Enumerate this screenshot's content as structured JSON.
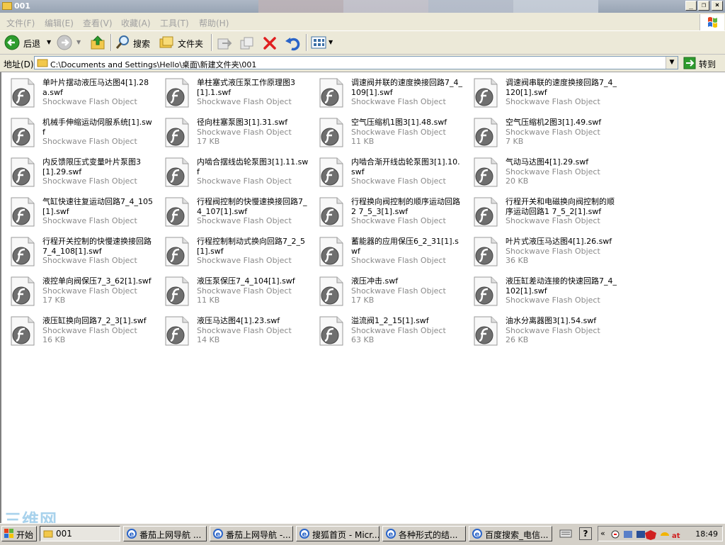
{
  "window": {
    "title": "001"
  },
  "menu": [
    "文件(F)",
    "编辑(E)",
    "查看(V)",
    "收藏(A)",
    "工具(T)",
    "帮助(H)"
  ],
  "toolbar": {
    "back_label": "后退",
    "search_label": "搜索",
    "folders_label": "文件夹"
  },
  "address": {
    "label": "地址(D)",
    "value": "C:\\Documents and Settings\\Hello\\桌面\\新建文件夹\\001",
    "go_label": "转到"
  },
  "files": [
    {
      "name": "单叶片摆动液压马达图4[1].28a.swf",
      "type": "Shockwave Flash Object",
      "size": ""
    },
    {
      "name": "单柱塞式液压泵工作原理图3[1].1.swf",
      "type": "Shockwave Flash Object",
      "size": ""
    },
    {
      "name": "调速阀并联的速度换接回路7_4_109[1].swf",
      "type": "Shockwave Flash Object",
      "size": ""
    },
    {
      "name": "调速阀串联的速度换接回路7_4_120[1].swf",
      "type": "Shockwave Flash Object",
      "size": ""
    },
    {
      "name": "机械手伸缩运动伺服系统[1].swf",
      "type": "Shockwave Flash Object",
      "size": ""
    },
    {
      "name": "径向柱塞泵图3[1].31.swf",
      "type": "Shockwave Flash Object",
      "size": "17 KB"
    },
    {
      "name": "空气压缩机1图3[1].48.swf",
      "type": "Shockwave Flash Object",
      "size": "11 KB"
    },
    {
      "name": "空气压缩机2图3[1].49.swf",
      "type": "Shockwave Flash Object",
      "size": "7 KB"
    },
    {
      "name": "内反馈限压式变量叶片泵图3[1].29.swf",
      "type": "Shockwave Flash Object",
      "size": ""
    },
    {
      "name": "内啮合摆线齿轮泵图3[1].11.swf",
      "type": "Shockwave Flash Object",
      "size": ""
    },
    {
      "name": "内啮合渐开线齿轮泵图3[1].10.swf",
      "type": "Shockwave Flash Object",
      "size": ""
    },
    {
      "name": "气动马达图4[1].29.swf",
      "type": "Shockwave Flash Object",
      "size": "20 KB"
    },
    {
      "name": "气缸快速往复运动回路7_4_105[1].swf",
      "type": "Shockwave Flash Object",
      "size": ""
    },
    {
      "name": "行程阀控制的快慢速换接回路7_4_107[1].swf",
      "type": "Shockwave Flash Object",
      "size": ""
    },
    {
      "name": "行程换向阀控制的顺序运动回路2 7_5_3[1].swf",
      "type": "Shockwave Flash Object",
      "size": ""
    },
    {
      "name": "行程开关和电磁换向阀控制的顺序运动回路1 7_5_2[1].swf",
      "type": "Shockwave Flash Object",
      "size": ""
    },
    {
      "name": "行程开关控制的快慢速换接回路7_4_108[1].swf",
      "type": "Shockwave Flash Object",
      "size": ""
    },
    {
      "name": "行程控制制动式换向回路7_2_5[1].swf",
      "type": "Shockwave Flash Object",
      "size": ""
    },
    {
      "name": "蓄能器的应用保压6_2_31[1].swf",
      "type": "Shockwave Flash Object",
      "size": ""
    },
    {
      "name": "叶片式液压马达图4[1].26.swf",
      "type": "Shockwave Flash Object",
      "size": "36 KB"
    },
    {
      "name": "液控单向阀保压7_3_62[1].swf",
      "type": "Shockwave Flash Object",
      "size": "17 KB"
    },
    {
      "name": "液压泵保压7_4_104[1].swf",
      "type": "Shockwave Flash Object",
      "size": "11 KB"
    },
    {
      "name": "液压冲击.swf",
      "type": "Shockwave Flash Object",
      "size": "17 KB"
    },
    {
      "name": "液压缸差动连接的快速回路7_4_102[1].swf",
      "type": "Shockwave Flash Object",
      "size": ""
    },
    {
      "name": "液压缸换向回路7_2_3[1].swf",
      "type": "Shockwave Flash Object",
      "size": "16 KB"
    },
    {
      "name": "液压马达图4[1].23.swf",
      "type": "Shockwave Flash Object",
      "size": "14 KB"
    },
    {
      "name": "溢流阀1_2_15[1].swf",
      "type": "Shockwave Flash Object",
      "size": "63 KB"
    },
    {
      "name": "油水分离器图3[1].54.swf",
      "type": "Shockwave Flash Object",
      "size": "26 KB"
    }
  ],
  "taskbar": {
    "start_label": "开始",
    "tasks": [
      {
        "label": "001",
        "active": true
      },
      {
        "label": "番茄上网导航 ..."
      },
      {
        "label": "番茄上网导航 -..."
      },
      {
        "label": "搜狐首页 - Micr..."
      },
      {
        "label": "各种形式的结..."
      },
      {
        "label": "百度搜索_电信..."
      }
    ],
    "clock": "18:49"
  },
  "watermark": "三维网",
  "colors": {
    "flash_icon": "#6f6f6f",
    "folder": "#f2c84a",
    "address_border": "#7f9db9",
    "watermark": "#8cc3e6"
  }
}
